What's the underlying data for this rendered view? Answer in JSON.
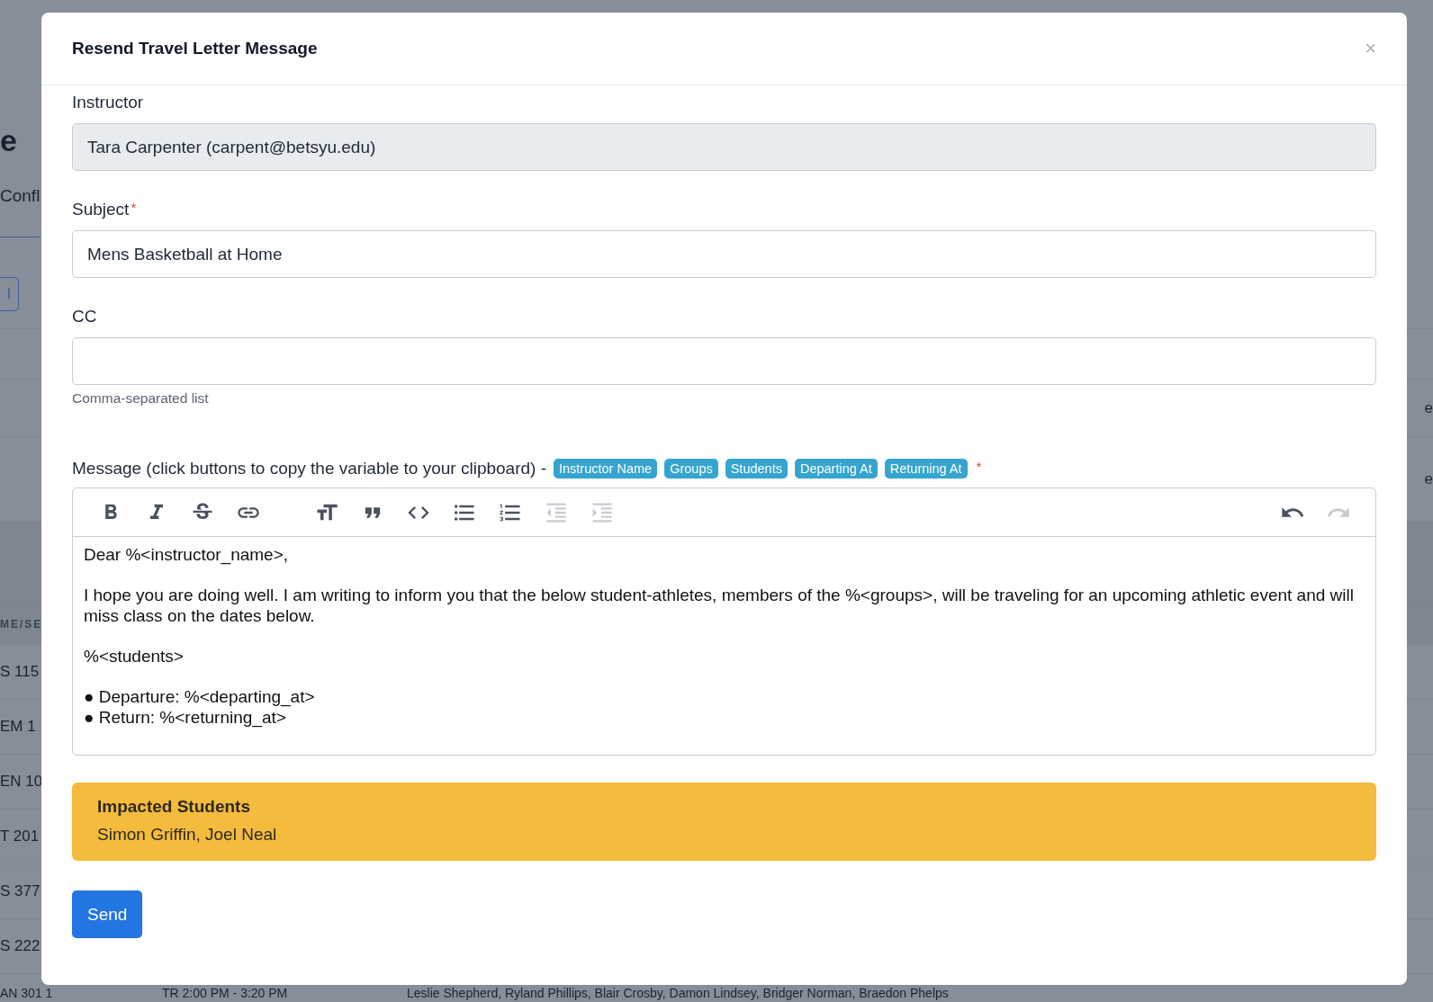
{
  "background": {
    "title": "e",
    "tab": "Confl",
    "button": "l",
    "header_cell": "ME/SE",
    "rows": [
      {
        "right": ""
      },
      {
        "right": "e"
      },
      {
        "right": "e"
      }
    ],
    "table_rows": [
      "S 115",
      "EM 1",
      "EN 10",
      "T 201",
      "S 377",
      "S 222"
    ],
    "last_row": {
      "course": "AN 301 1",
      "time": "TR 2:00 PM - 3:20 PM",
      "students": "Leslie Shepherd, Ryland Phillips, Blair Crosby, Damon Lindsey, Bridger Norman, Braedon Phelps"
    }
  },
  "modal": {
    "title": "Resend Travel Letter Message",
    "close": "×",
    "fields": [
      {
        "label": "Instructor",
        "value": "Tara Carpenter (carpent@betsyu.edu)",
        "disabled": true
      },
      {
        "label": "Subject",
        "required_mark": "*",
        "value": "Mens Basketball at Home",
        "disabled": false
      },
      {
        "label": "CC",
        "disabled": false,
        "help": "Comma-separated list"
      }
    ],
    "message": {
      "label": "Message (click buttons to copy the variable to your clipboard) -",
      "required_mark": "*",
      "variables": [
        "Instructor Name",
        "Groups",
        "Students",
        "Departing At",
        "Returning At"
      ],
      "toolbar": [
        {
          "kind": "bold",
          "disabled": false
        },
        {
          "kind": "italic",
          "disabled": false
        },
        {
          "kind": "strike",
          "disabled": false
        },
        {
          "kind": "link",
          "disabled": false
        },
        {
          "kind": "spacer"
        },
        {
          "kind": "heading",
          "disabled": false
        },
        {
          "kind": "quote",
          "disabled": false
        },
        {
          "kind": "code",
          "disabled": false
        },
        {
          "kind": "bullets",
          "disabled": false
        },
        {
          "kind": "numbers",
          "disabled": false
        },
        {
          "kind": "outdent",
          "disabled": true
        },
        {
          "kind": "indent",
          "disabled": true
        },
        {
          "kind": "flex"
        },
        {
          "kind": "undo",
          "disabled": false
        },
        {
          "kind": "redo",
          "disabled": true
        }
      ],
      "blocks": [
        {
          "kind": "paragraph",
          "text": "Dear %<instructor_name>,"
        },
        {
          "kind": "paragraph",
          "text": "I hope you are doing well. I am writing to inform you that the below student-athletes, members of the %<groups>, will be traveling for an upcoming athletic event and will miss class on the dates below."
        },
        {
          "kind": "paragraph",
          "text": "%<students>"
        },
        {
          "kind": "bullets",
          "items": [
            {
              "bullet": "●",
              "text": "Departure: %<departing_at>"
            },
            {
              "bullet": "●",
              "text": "Return: %<returning_at>"
            }
          ]
        }
      ]
    },
    "alert": {
      "title": "Impacted Students",
      "text": "Simon Griffin, Joel Neal"
    },
    "send": "Send"
  }
}
